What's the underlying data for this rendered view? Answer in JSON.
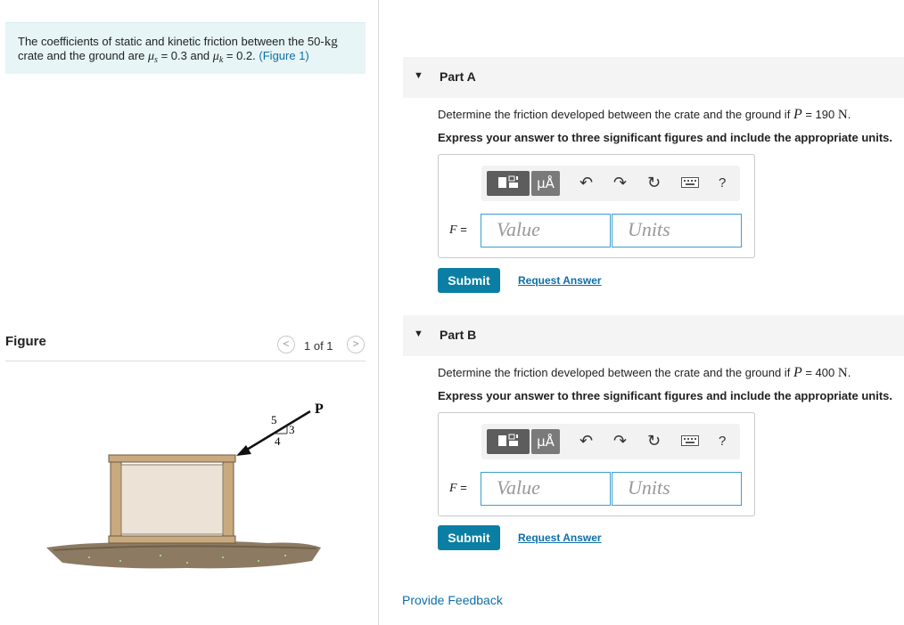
{
  "problem": {
    "text_1": "The coefficients of static and kinetic friction between the 50-",
    "mass_unit": "kg",
    "text_2": "crate and the ground are",
    "mu_s_symbol": "μ",
    "mu_s_sub": "s",
    "mu_s_value": "= 0.3 and",
    "mu_k_symbol": "μ",
    "mu_k_sub": "k",
    "mu_k_value": "= 0.2.",
    "figure_link": "(Figure 1)"
  },
  "figure_panel": {
    "title": "Figure",
    "pager": "1 of 1",
    "prev": "<",
    "next": ">",
    "labels": {
      "force": "P",
      "hyp": "5",
      "rise": "3",
      "run": "4"
    }
  },
  "parts": [
    {
      "header": "Part A",
      "question_prefix": "Determine the friction developed between the crate and the ground if",
      "var": "P",
      "value": "= 190",
      "unit": "N",
      "period": ".",
      "instruction": "Express your answer to three significant figures and include the appropriate units.",
      "answer_label_var": "F",
      "answer_label_eq": "=",
      "value_placeholder": "Value",
      "units_placeholder": "Units",
      "submit": "Submit",
      "request": "Request Answer"
    },
    {
      "header": "Part B",
      "question_prefix": "Determine the friction developed between the crate and the ground if",
      "var": "P",
      "value": "= 400",
      "unit": "N",
      "period": ".",
      "instruction": "Express your answer to three significant figures and include the appropriate units.",
      "answer_label_var": "F",
      "answer_label_eq": "=",
      "value_placeholder": "Value",
      "units_placeholder": "Units",
      "submit": "Submit",
      "request": "Request Answer"
    }
  ],
  "toolbar": {
    "mu_label": "μÅ",
    "help": "?",
    "icons": [
      "templates-icon",
      "units-icon",
      "undo-icon",
      "redo-icon",
      "reset-icon",
      "keyboard-icon",
      "help-icon"
    ]
  },
  "feedback": "Provide Feedback",
  "colors": {
    "accent": "#0b7fa3",
    "link": "#0e6fa8",
    "problem_bg": "#e7f5f7",
    "field_border": "#3a9fd0"
  }
}
